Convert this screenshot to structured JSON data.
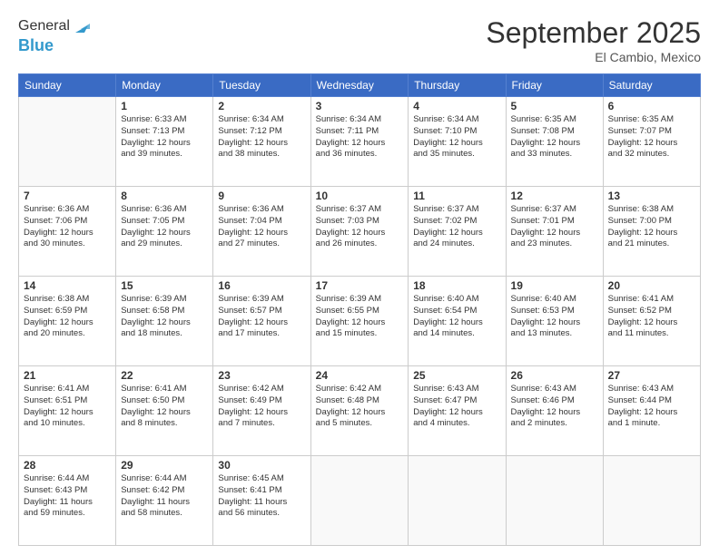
{
  "header": {
    "logo_line1": "General",
    "logo_line2": "Blue",
    "month_title": "September 2025",
    "location": "El Cambio, Mexico"
  },
  "weekdays": [
    "Sunday",
    "Monday",
    "Tuesday",
    "Wednesday",
    "Thursday",
    "Friday",
    "Saturday"
  ],
  "weeks": [
    [
      {
        "day": "",
        "info": ""
      },
      {
        "day": "1",
        "info": "Sunrise: 6:33 AM\nSunset: 7:13 PM\nDaylight: 12 hours\nand 39 minutes."
      },
      {
        "day": "2",
        "info": "Sunrise: 6:34 AM\nSunset: 7:12 PM\nDaylight: 12 hours\nand 38 minutes."
      },
      {
        "day": "3",
        "info": "Sunrise: 6:34 AM\nSunset: 7:11 PM\nDaylight: 12 hours\nand 36 minutes."
      },
      {
        "day": "4",
        "info": "Sunrise: 6:34 AM\nSunset: 7:10 PM\nDaylight: 12 hours\nand 35 minutes."
      },
      {
        "day": "5",
        "info": "Sunrise: 6:35 AM\nSunset: 7:08 PM\nDaylight: 12 hours\nand 33 minutes."
      },
      {
        "day": "6",
        "info": "Sunrise: 6:35 AM\nSunset: 7:07 PM\nDaylight: 12 hours\nand 32 minutes."
      }
    ],
    [
      {
        "day": "7",
        "info": "Sunrise: 6:36 AM\nSunset: 7:06 PM\nDaylight: 12 hours\nand 30 minutes."
      },
      {
        "day": "8",
        "info": "Sunrise: 6:36 AM\nSunset: 7:05 PM\nDaylight: 12 hours\nand 29 minutes."
      },
      {
        "day": "9",
        "info": "Sunrise: 6:36 AM\nSunset: 7:04 PM\nDaylight: 12 hours\nand 27 minutes."
      },
      {
        "day": "10",
        "info": "Sunrise: 6:37 AM\nSunset: 7:03 PM\nDaylight: 12 hours\nand 26 minutes."
      },
      {
        "day": "11",
        "info": "Sunrise: 6:37 AM\nSunset: 7:02 PM\nDaylight: 12 hours\nand 24 minutes."
      },
      {
        "day": "12",
        "info": "Sunrise: 6:37 AM\nSunset: 7:01 PM\nDaylight: 12 hours\nand 23 minutes."
      },
      {
        "day": "13",
        "info": "Sunrise: 6:38 AM\nSunset: 7:00 PM\nDaylight: 12 hours\nand 21 minutes."
      }
    ],
    [
      {
        "day": "14",
        "info": "Sunrise: 6:38 AM\nSunset: 6:59 PM\nDaylight: 12 hours\nand 20 minutes."
      },
      {
        "day": "15",
        "info": "Sunrise: 6:39 AM\nSunset: 6:58 PM\nDaylight: 12 hours\nand 18 minutes."
      },
      {
        "day": "16",
        "info": "Sunrise: 6:39 AM\nSunset: 6:57 PM\nDaylight: 12 hours\nand 17 minutes."
      },
      {
        "day": "17",
        "info": "Sunrise: 6:39 AM\nSunset: 6:55 PM\nDaylight: 12 hours\nand 15 minutes."
      },
      {
        "day": "18",
        "info": "Sunrise: 6:40 AM\nSunset: 6:54 PM\nDaylight: 12 hours\nand 14 minutes."
      },
      {
        "day": "19",
        "info": "Sunrise: 6:40 AM\nSunset: 6:53 PM\nDaylight: 12 hours\nand 13 minutes."
      },
      {
        "day": "20",
        "info": "Sunrise: 6:41 AM\nSunset: 6:52 PM\nDaylight: 12 hours\nand 11 minutes."
      }
    ],
    [
      {
        "day": "21",
        "info": "Sunrise: 6:41 AM\nSunset: 6:51 PM\nDaylight: 12 hours\nand 10 minutes."
      },
      {
        "day": "22",
        "info": "Sunrise: 6:41 AM\nSunset: 6:50 PM\nDaylight: 12 hours\nand 8 minutes."
      },
      {
        "day": "23",
        "info": "Sunrise: 6:42 AM\nSunset: 6:49 PM\nDaylight: 12 hours\nand 7 minutes."
      },
      {
        "day": "24",
        "info": "Sunrise: 6:42 AM\nSunset: 6:48 PM\nDaylight: 12 hours\nand 5 minutes."
      },
      {
        "day": "25",
        "info": "Sunrise: 6:43 AM\nSunset: 6:47 PM\nDaylight: 12 hours\nand 4 minutes."
      },
      {
        "day": "26",
        "info": "Sunrise: 6:43 AM\nSunset: 6:46 PM\nDaylight: 12 hours\nand 2 minutes."
      },
      {
        "day": "27",
        "info": "Sunrise: 6:43 AM\nSunset: 6:44 PM\nDaylight: 12 hours\nand 1 minute."
      }
    ],
    [
      {
        "day": "28",
        "info": "Sunrise: 6:44 AM\nSunset: 6:43 PM\nDaylight: 11 hours\nand 59 minutes."
      },
      {
        "day": "29",
        "info": "Sunrise: 6:44 AM\nSunset: 6:42 PM\nDaylight: 11 hours\nand 58 minutes."
      },
      {
        "day": "30",
        "info": "Sunrise: 6:45 AM\nSunset: 6:41 PM\nDaylight: 11 hours\nand 56 minutes."
      },
      {
        "day": "",
        "info": ""
      },
      {
        "day": "",
        "info": ""
      },
      {
        "day": "",
        "info": ""
      },
      {
        "day": "",
        "info": ""
      }
    ]
  ]
}
